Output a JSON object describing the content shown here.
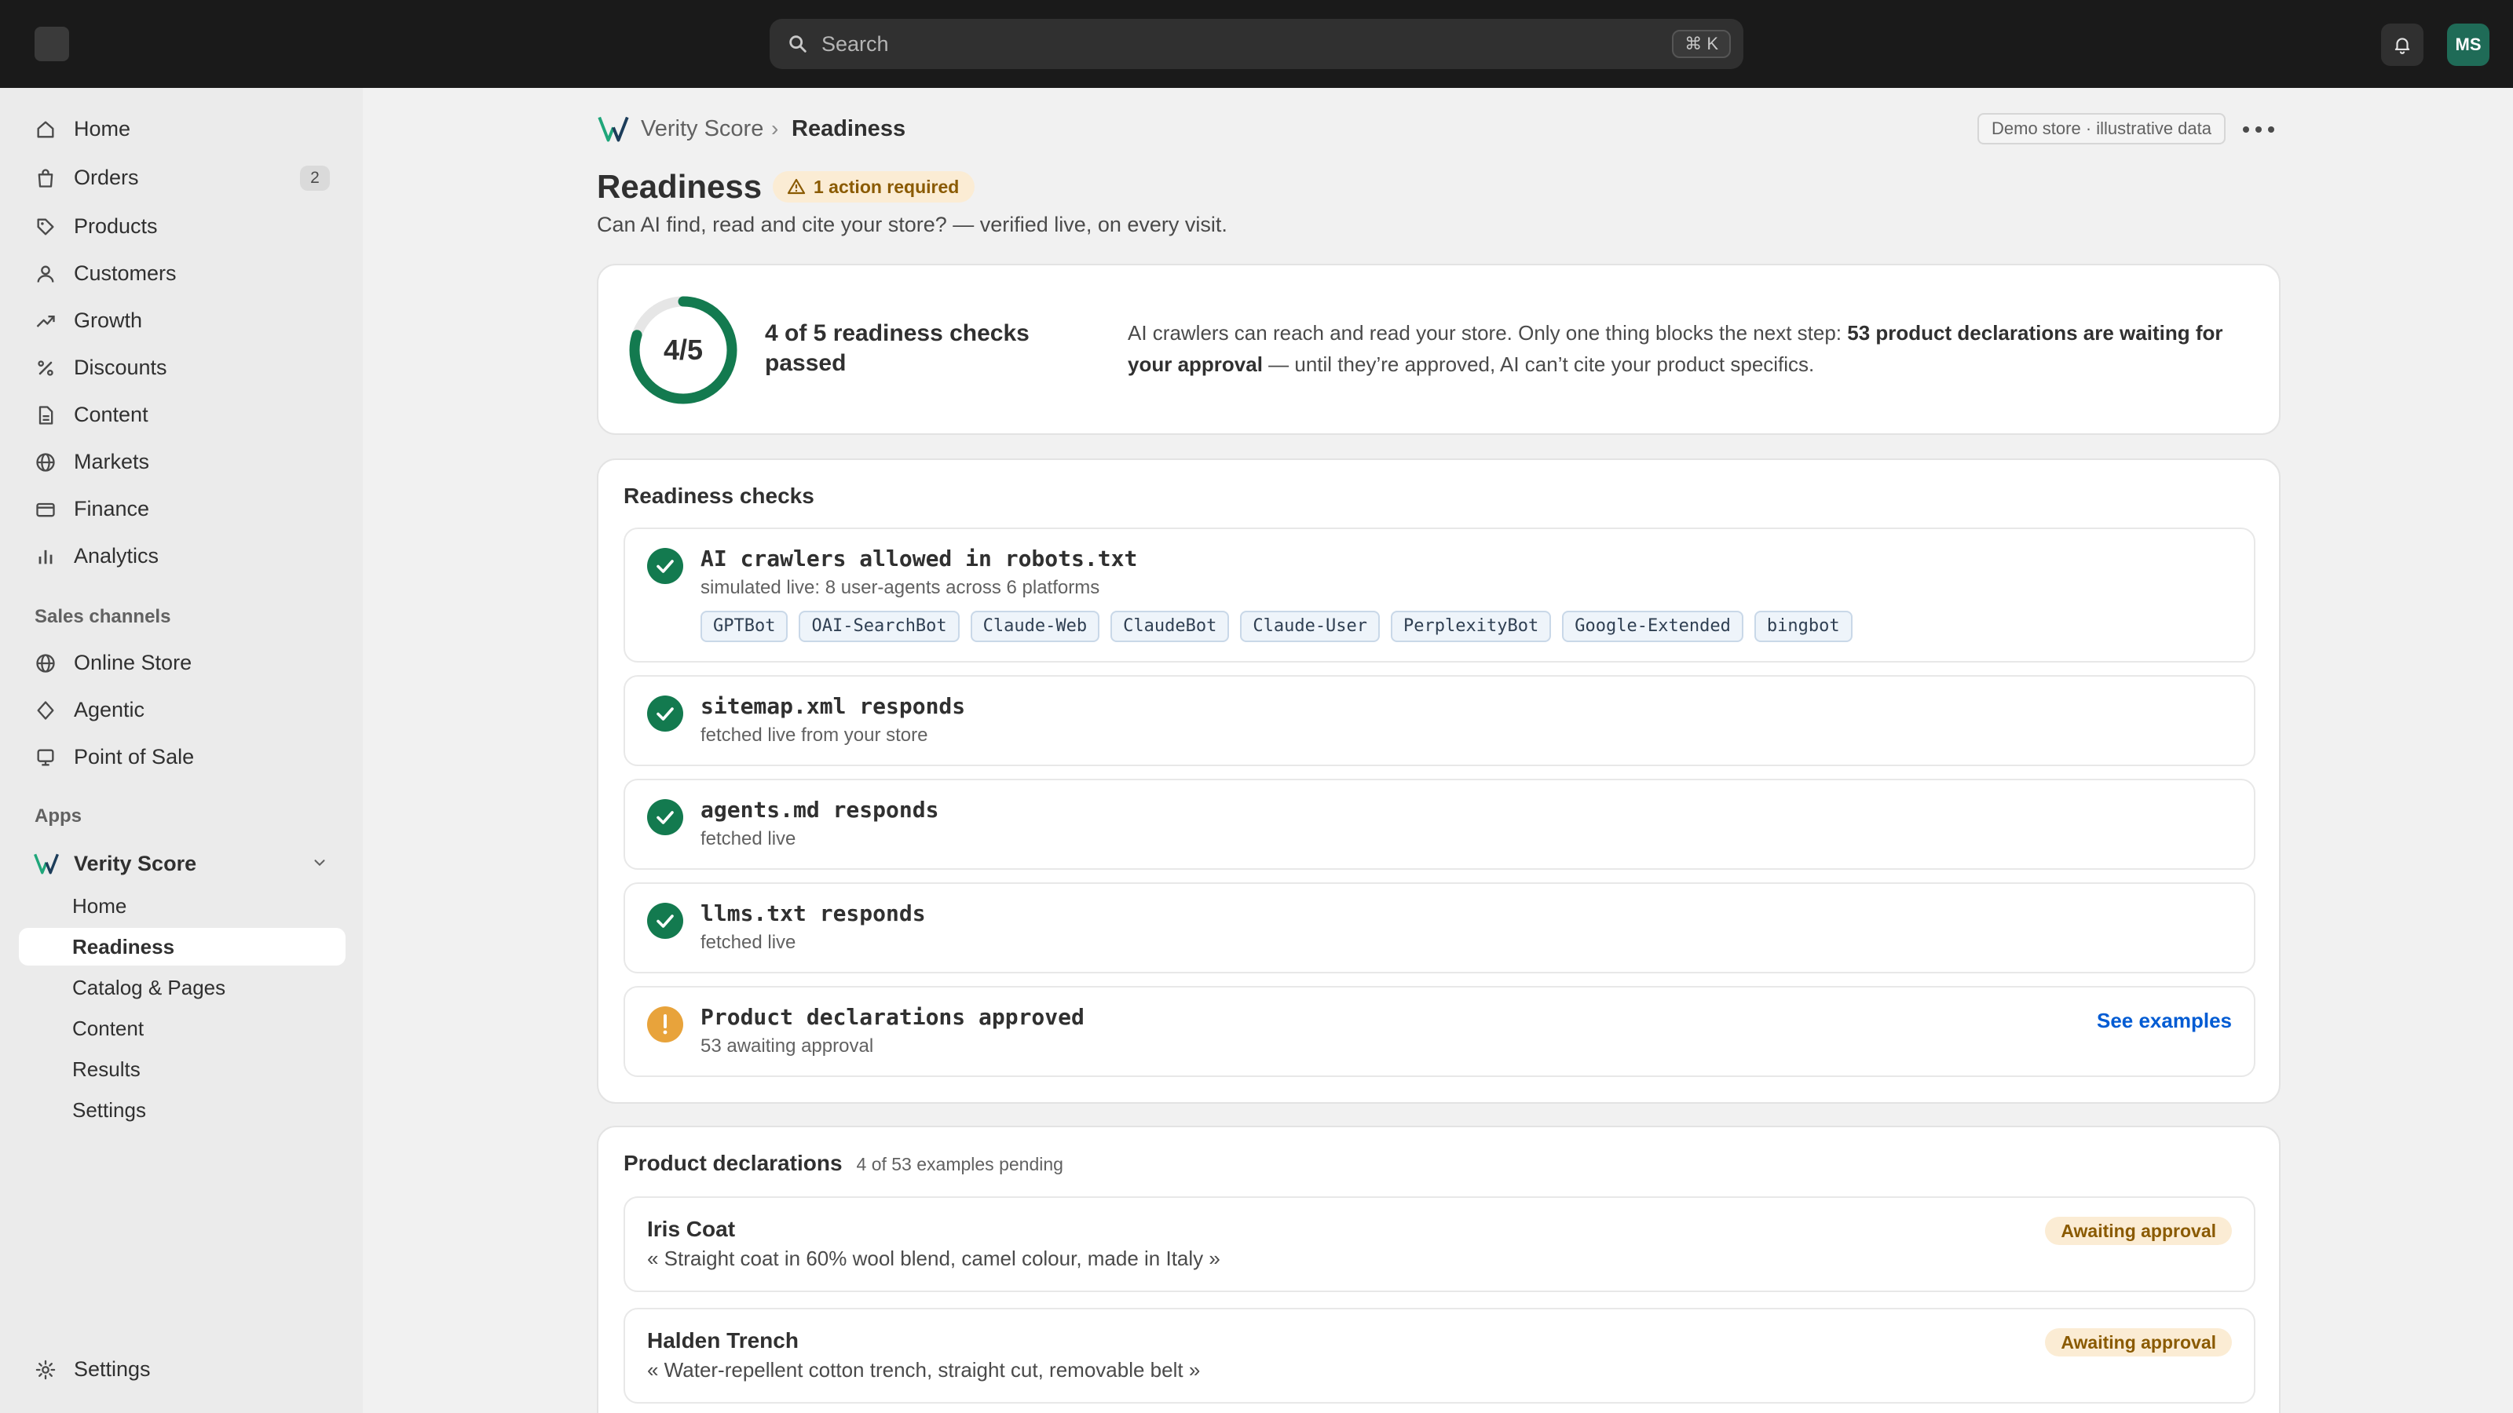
{
  "topbar": {
    "search_placeholder": "Search",
    "shortcut": "⌘ K",
    "avatar_initials": "MS"
  },
  "sidebar": {
    "items": [
      {
        "label": "Home",
        "icon": "home-icon"
      },
      {
        "label": "Orders",
        "icon": "orders-icon",
        "count": "2"
      },
      {
        "label": "Products",
        "icon": "tag-icon"
      },
      {
        "label": "Customers",
        "icon": "person-icon"
      },
      {
        "label": "Growth",
        "icon": "trend-icon"
      },
      {
        "label": "Discounts",
        "icon": "percent-icon"
      },
      {
        "label": "Content",
        "icon": "document-icon"
      },
      {
        "label": "Markets",
        "icon": "globe-icon"
      },
      {
        "label": "Finance",
        "icon": "card-icon"
      },
      {
        "label": "Analytics",
        "icon": "bar-chart-icon"
      }
    ],
    "sales_channels_title": "Sales channels",
    "sales_channels": [
      {
        "label": "Online Store",
        "icon": "globe-icon"
      },
      {
        "label": "Agentic",
        "icon": "diamond-icon"
      },
      {
        "label": "Point of Sale",
        "icon": "pos-icon"
      }
    ],
    "apps_title": "Apps",
    "app_name": "Verity Score",
    "app_subitems": [
      "Home",
      "Readiness",
      "Catalog & Pages",
      "Content",
      "Results",
      "Settings"
    ],
    "settings_label": "Settings"
  },
  "breadcrumb": {
    "app": "Verity Score",
    "separator": "›",
    "current": "Readiness"
  },
  "demo_badge": "Demo store · illustrative data",
  "page": {
    "title": "Readiness",
    "action_badge": "1 action required",
    "subtitle": "Can AI find, read and cite your store? — verified live, on every visit."
  },
  "summary": {
    "score": "4/5",
    "score_fraction": 0.8,
    "title": "4 of 5 readiness checks passed",
    "text_before": "AI crawlers can reach and read your store. Only one thing blocks the next step: ",
    "text_bold": "53 product declarations are waiting for your approval",
    "text_after": " — until they’re approved, AI can’t cite your product specifics."
  },
  "checks": {
    "title": "Readiness checks",
    "items": [
      {
        "name": "AI crawlers allowed in robots.txt",
        "meta": "simulated live: 8 user-agents across 6 platforms",
        "status": "pass"
      },
      {
        "name": "sitemap.xml responds",
        "meta": "fetched live from your store",
        "status": "pass"
      },
      {
        "name": "agents.md responds",
        "meta": "fetched live",
        "status": "pass"
      },
      {
        "name": "llms.txt responds",
        "meta": "fetched live",
        "status": "pass"
      },
      {
        "name": "Product declarations approved",
        "meta": "53 awaiting approval",
        "status": "warning",
        "link": "See examples"
      }
    ],
    "agents": [
      "GPTBot",
      "OAI-SearchBot",
      "Claude-Web",
      "ClaudeBot",
      "Claude-User",
      "PerplexityBot",
      "Google-Extended",
      "bingbot"
    ]
  },
  "declarations": {
    "title": "Product declarations",
    "subtitle": "4 of 53 examples pending",
    "items": [
      {
        "name": "Iris Coat",
        "quote": "« Straight coat in 60% wool blend, camel colour, made in Italy »",
        "status": "Awaiting approval"
      },
      {
        "name": "Halden Trench",
        "quote": "« Water-repellent cotton trench, straight cut, removable belt »",
        "status": "Awaiting approval"
      }
    ]
  },
  "colors": {
    "topbar": "#1a1a1a",
    "success": "#137a4f",
    "warning": "#e8a33b",
    "link": "#005bd3",
    "brand_icon": "#1fa67a"
  }
}
